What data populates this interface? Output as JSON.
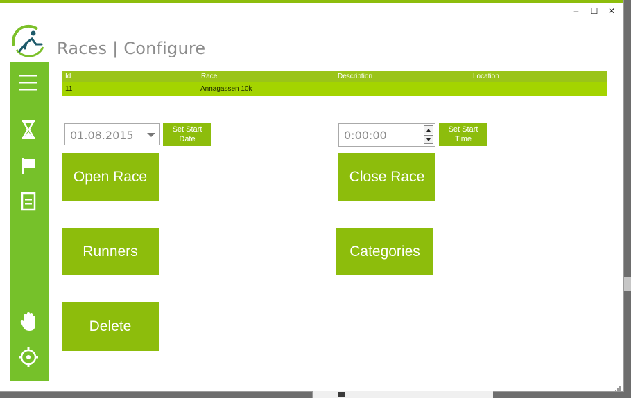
{
  "window": {
    "title": "Races | Configure",
    "controls": {
      "minimize": "–",
      "maximize": "☐",
      "close": "✕"
    }
  },
  "sidebar": {
    "items": [
      {
        "name": "menu-icon"
      },
      {
        "name": "hourglass-icon"
      },
      {
        "name": "flag-icon"
      },
      {
        "name": "list-icon"
      },
      {
        "name": "hand-icon"
      },
      {
        "name": "settings-icon"
      }
    ]
  },
  "grid": {
    "columns": [
      "Id",
      "Race",
      "Description",
      "Location"
    ],
    "rows": [
      {
        "id": "11",
        "race": "Annagassen 10k",
        "description": "",
        "location": ""
      }
    ]
  },
  "start_date": {
    "value": "01.08.2015",
    "button_label": "Set Start Date"
  },
  "start_time": {
    "value": "0:00:00",
    "button_label": "Set Start Time"
  },
  "buttons": {
    "open_race": "Open Race",
    "close_race": "Close Race",
    "runners": "Runners",
    "categories": "Categories",
    "delete": "Delete"
  },
  "colors": {
    "accent": "#8dbd0c",
    "sidebar": "#76c12a",
    "grid_header": "#9ac419",
    "grid_row": "#a4d400",
    "title": "#8c8c8c"
  }
}
